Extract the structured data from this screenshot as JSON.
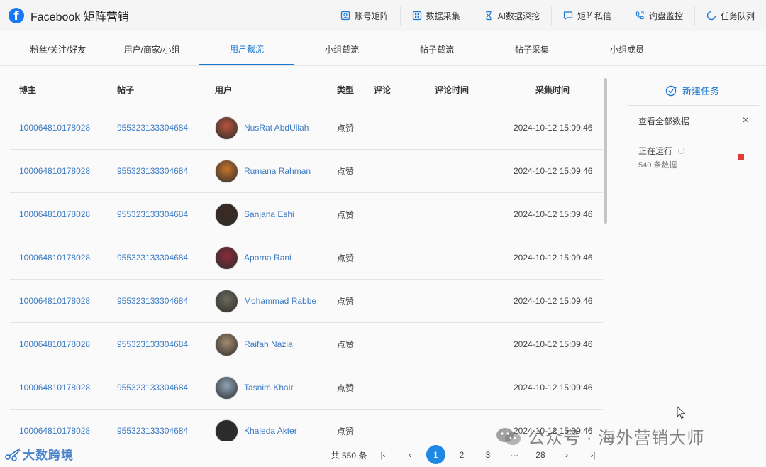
{
  "header": {
    "brand_title": "Facebook 矩阵营销",
    "nav": [
      {
        "label": "账号矩阵",
        "icon": "account-icon"
      },
      {
        "label": "数据采集",
        "icon": "grid-icon"
      },
      {
        "label": "AI数据深挖",
        "icon": "hourglass-icon"
      },
      {
        "label": "矩阵私信",
        "icon": "message-icon"
      },
      {
        "label": "询盘监控",
        "icon": "phone-icon"
      },
      {
        "label": "任务队列",
        "icon": "loading-icon"
      }
    ]
  },
  "tabs": [
    {
      "label": "粉丝/关注/好友"
    },
    {
      "label": "用户/商家/小组"
    },
    {
      "label": "用户截流",
      "active": true
    },
    {
      "label": "小组截流"
    },
    {
      "label": "帖子截流"
    },
    {
      "label": "帖子采集"
    },
    {
      "label": "小组成员"
    }
  ],
  "table": {
    "headers": [
      "博主",
      "帖子",
      "用户",
      "类型",
      "评论",
      "评论时间",
      "采集时间"
    ],
    "rows": [
      {
        "blogger": "100064810178028",
        "post": "955323133304684",
        "user": "NusRat AbdUllah",
        "type": "点赞",
        "comment": "",
        "comment_time": "",
        "collect_time": "2024-10-12 15:09:46",
        "avatar_color": "#b5543c"
      },
      {
        "blogger": "100064810178028",
        "post": "955323133304684",
        "user": "Rumana Rahman",
        "type": "点赞",
        "comment": "",
        "comment_time": "",
        "collect_time": "2024-10-12 15:09:46",
        "avatar_color": "#c8742b"
      },
      {
        "blogger": "100064810178028",
        "post": "955323133304684",
        "user": "Sanjana Eshi",
        "type": "点赞",
        "comment": "",
        "comment_time": "",
        "collect_time": "2024-10-12 15:09:46",
        "avatar_color": "#3d2a22"
      },
      {
        "blogger": "100064810178028",
        "post": "955323133304684",
        "user": "Aporna Rani",
        "type": "点赞",
        "comment": "",
        "comment_time": "",
        "collect_time": "2024-10-12 15:09:46",
        "avatar_color": "#8a2c3a"
      },
      {
        "blogger": "100064810178028",
        "post": "955323133304684",
        "user": "Mohammad Rabbe",
        "type": "点赞",
        "comment": "",
        "comment_time": "",
        "collect_time": "2024-10-12 15:09:46",
        "avatar_color": "#6d6a5c"
      },
      {
        "blogger": "100064810178028",
        "post": "955323133304684",
        "user": "Raifah Nazia",
        "type": "点赞",
        "comment": "",
        "comment_time": "",
        "collect_time": "2024-10-12 15:09:46",
        "avatar_color": "#a48a6e"
      },
      {
        "blogger": "100064810178028",
        "post": "955323133304684",
        "user": "Tasnim Khair",
        "type": "点赞",
        "comment": "",
        "comment_time": "",
        "collect_time": "2024-10-12 15:09:46",
        "avatar_color": "#8fa4b8"
      },
      {
        "blogger": "100064810178028",
        "post": "955323133304684",
        "user": "Khaleda Akter",
        "type": "点赞",
        "comment": "",
        "comment_time": "",
        "collect_time": "2024-10-12 15:09:46",
        "avatar_color": "#2a2a2a"
      }
    ]
  },
  "right_panel": {
    "new_task_label": "新建任务",
    "view_all_label": "查看全部数据",
    "close_label": "×",
    "status_label": "正在运行",
    "count_label": "540 条数据"
  },
  "pagination": {
    "total_label": "共 550 条",
    "first_label": "|‹",
    "prev_label": "‹",
    "pages": [
      "1",
      "2",
      "3"
    ],
    "active_page": "1",
    "ellipsis": "···",
    "last_page": "28",
    "next_label": "›",
    "end_label": "›|"
  },
  "bottom_logo": {
    "text": "大数跨境"
  },
  "watermark": {
    "text": "公众号 · 海外营销大师"
  },
  "colors": {
    "accent": "#1976d2",
    "link": "#3b7bc4",
    "stop": "#e53935"
  }
}
